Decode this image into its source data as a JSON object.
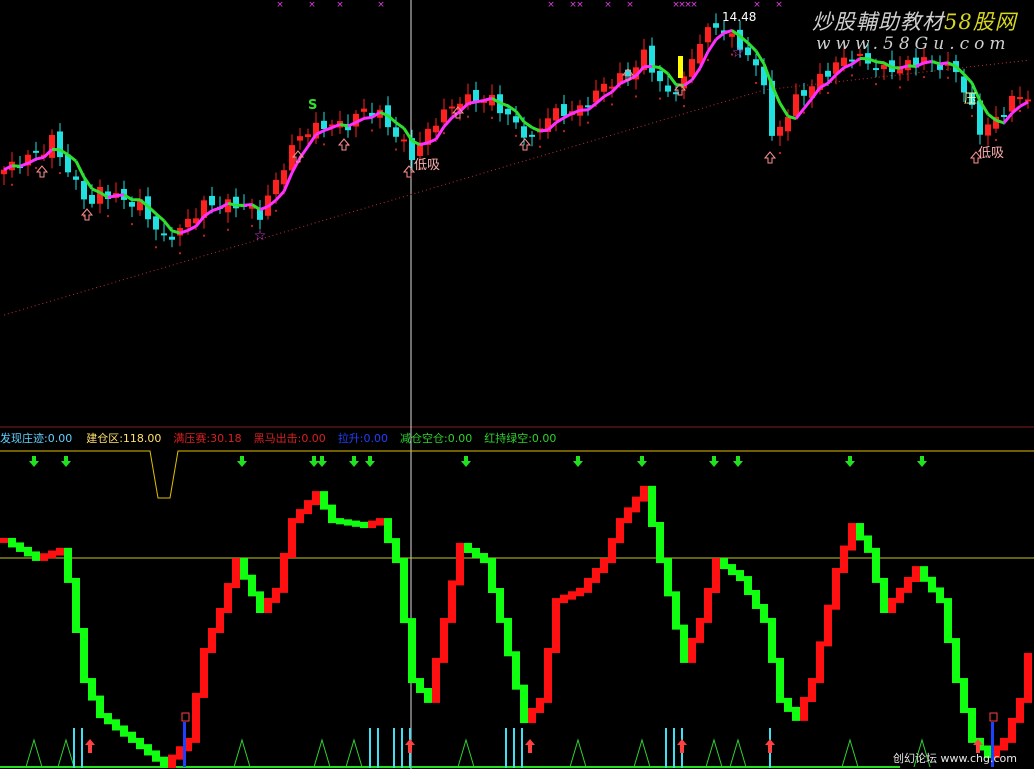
{
  "header": {
    "labels": [
      {
        "name": "发现庄迹",
        "value": "0.00",
        "color": "#60d0ff"
      },
      {
        "name": "建仓区",
        "value": "118.00",
        "color": "#ffe070"
      },
      {
        "name": "满压赛",
        "value": "30.18",
        "color": "#d82020"
      },
      {
        "name": "黑马出击",
        "value": "0.00",
        "color": "#d82020"
      },
      {
        "name": "拉升",
        "value": "0.00",
        "color": "#2040ff"
      },
      {
        "name": "减仓空仓",
        "value": "0.00",
        "color": "#30d030"
      },
      {
        "name": "红持绿空",
        "value": "0.00",
        "color": "#30d030"
      }
    ]
  },
  "watermark": {
    "title_a": "炒股輔助教材",
    "title_b": "58股网",
    "url": "www.58Gu.com",
    "footer": "创幻论坛 www.chg.com"
  },
  "annotations": {
    "high_price": "14.48",
    "buy_low_1": "低吸",
    "buy_low_2": "低吸",
    "sell_mark": "S",
    "reverse_mark": "压"
  },
  "colors": {
    "up": "#ff2020",
    "down": "#20e0e0",
    "ma_up": "#ff30ff",
    "ma_down": "#30e030",
    "osc_up": "#ff1010",
    "osc_down": "#10ff10",
    "grid": "#c8c820"
  },
  "chart_data": {
    "type": "candlestick",
    "price_keypoints": {
      "index": [
        0,
        5,
        6,
        9,
        11,
        12,
        15,
        17,
        20,
        22,
        25,
        30,
        32,
        35,
        37,
        40,
        43,
        45,
        47,
        50,
        51,
        54,
        57,
        61,
        64,
        66,
        68,
        72,
        75,
        78,
        80,
        83,
        85,
        87,
        89,
        92,
        95,
        96,
        99,
        101,
        104,
        106,
        110,
        115,
        119,
        122,
        124,
        126,
        128
      ],
      "close": [
        12.79,
        13.01,
        13.12,
        12.62,
        12.4,
        12.56,
        12.45,
        12.4,
        12.01,
        12.12,
        12.4,
        12.4,
        12.29,
        12.84,
        13.18,
        13.29,
        13.29,
        13.46,
        13.4,
        13.07,
        12.95,
        13.34,
        13.57,
        13.57,
        13.29,
        13.12,
        13.4,
        13.46,
        13.73,
        13.85,
        14.07,
        13.62,
        13.79,
        14.24,
        14.4,
        14.18,
        13.79,
        13.12,
        13.57,
        13.73,
        13.96,
        14.07,
        13.9,
        14.01,
        13.9,
        13.23,
        13.34,
        13.57,
        13.62
      ]
    },
    "price_high": 14.48,
    "oscillator": {
      "index": [
        0,
        4,
        7,
        8,
        10,
        12,
        16,
        20,
        23,
        25,
        27,
        29,
        32,
        34,
        36,
        39,
        41,
        45,
        47,
        49,
        51,
        53,
        55,
        57,
        60,
        62,
        65,
        67,
        69,
        72,
        75,
        77,
        80,
        82,
        85,
        87,
        89,
        92,
        95,
        97,
        99,
        101,
        104,
        106,
        108,
        110,
        112,
        114,
        117,
        119,
        121,
        123,
        125,
        127,
        128
      ],
      "value": [
        72.6,
        66.8,
        69.4,
        59.7,
        27.4,
        16.1,
        8.1,
        0,
        8.1,
        37.1,
        50.0,
        66.1,
        50.0,
        56.5,
        79.0,
        87.7,
        79.0,
        77.4,
        79.0,
        66.1,
        27.4,
        21.0,
        46.8,
        71.0,
        66.1,
        46.8,
        14.5,
        21.0,
        53.2,
        56.5,
        66.1,
        79.0,
        89.4,
        66.1,
        33.9,
        46.8,
        66.1,
        60.3,
        46.8,
        21.0,
        15.2,
        27.4,
        62.9,
        77.4,
        69.4,
        50.0,
        56.5,
        63.5,
        53.2,
        27.4,
        8.1,
        3.2,
        8.1,
        21.0,
        35.5
      ],
      "ylim": [
        0,
        100
      ],
      "reference_line": 66.8
    },
    "signal_arrows_index": [
      4,
      8,
      30,
      39,
      40,
      44,
      46,
      58,
      72,
      80,
      89,
      92,
      106,
      115
    ],
    "volume_spikes_index": [
      4,
      8,
      30,
      40,
      44,
      58,
      72,
      80,
      89,
      92,
      106,
      115
    ],
    "cyan_bars_index": [
      9,
      10,
      46,
      47,
      49,
      50,
      51,
      63,
      64,
      65,
      83,
      84,
      85,
      96
    ],
    "red_up_arrows_index": [
      11,
      51,
      66,
      85,
      96,
      122
    ],
    "blue_bars_index": [
      23,
      124
    ]
  }
}
